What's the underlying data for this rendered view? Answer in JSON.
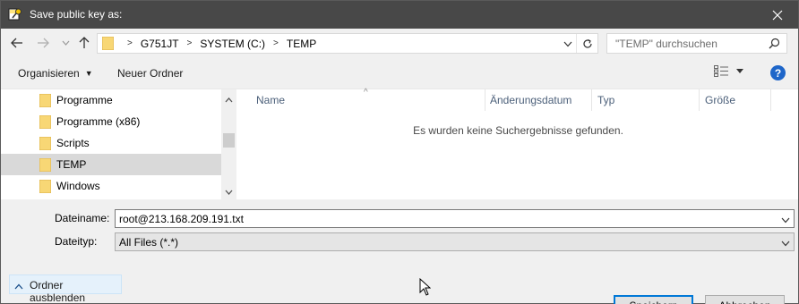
{
  "window": {
    "title": "Save public key as:"
  },
  "address": {
    "breadcrumbs": [
      "G751JT",
      "SYSTEM (C:)",
      "TEMP"
    ],
    "search_placeholder": "\"TEMP\" durchsuchen"
  },
  "toolbar": {
    "organize_label": "Organisieren",
    "new_folder_label": "Neuer Ordner",
    "help_label": "?"
  },
  "nav": {
    "items": [
      {
        "label": "Programme",
        "selected": false
      },
      {
        "label": "Programme (x86)",
        "selected": false
      },
      {
        "label": "Scripts",
        "selected": false
      },
      {
        "label": "TEMP",
        "selected": true
      },
      {
        "label": "Windows",
        "selected": false
      }
    ]
  },
  "files": {
    "columns": [
      "Name",
      "Änderungsdatum",
      "Typ",
      "Größe"
    ],
    "empty_message": "Es wurden keine Suchergebnisse gefunden."
  },
  "form": {
    "filename_label": "Dateiname:",
    "filename_value": "root@213.168.209.191.txt",
    "filetype_label": "Dateityp:",
    "filetype_value": "All Files (*.*)"
  },
  "buttons": {
    "hide_folders_label": "Ordner ausblenden",
    "save_label": "Speichern",
    "cancel_label": "Abbrechen"
  },
  "colors": {
    "titlebar": "#484848",
    "selection": "#d9d9d9",
    "accent": "#0078d7",
    "folder": "#f8d775"
  }
}
